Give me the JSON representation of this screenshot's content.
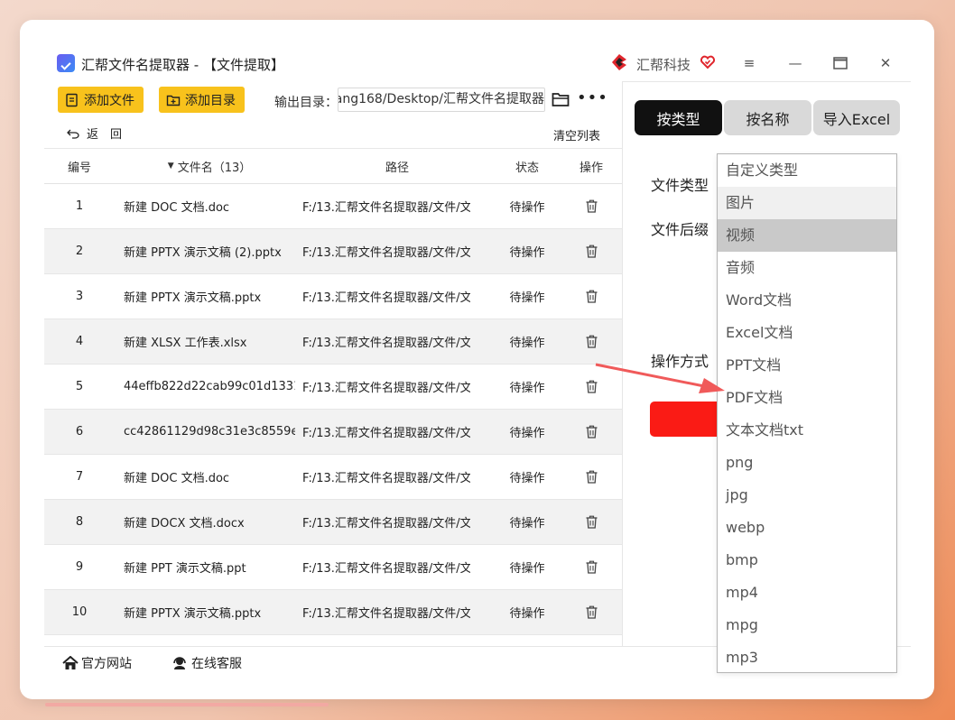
{
  "window": {
    "title": "汇帮文件名提取器 - 【文件提取】",
    "brand": "汇帮科技",
    "controls": {
      "menu": "≡",
      "minimize": "—",
      "maximize": "☐",
      "close": "✕"
    }
  },
  "toolbar": {
    "add_file": "添加文件",
    "add_dir": "添加目录",
    "output_label": "输出目录：",
    "output_path": "ang168/Desktop/汇帮文件名提取器",
    "more": "•••"
  },
  "subbar": {
    "back": "返　回",
    "clear": "清空列表"
  },
  "table": {
    "headers": {
      "num": "编号",
      "name": "文件名（13）",
      "path": "路径",
      "status": "状态",
      "op": "操作"
    },
    "rows": [
      {
        "num": "1",
        "name": "新建 DOC 文档.doc",
        "path": "F:/13.汇帮文件名提取器/文件/文...",
        "status": "待操作"
      },
      {
        "num": "2",
        "name": "新建 PPTX 演示文稿 (2).pptx",
        "path": "F:/13.汇帮文件名提取器/文件/文...",
        "status": "待操作"
      },
      {
        "num": "3",
        "name": "新建 PPTX 演示文稿.pptx",
        "path": "F:/13.汇帮文件名提取器/文件/文...",
        "status": "待操作"
      },
      {
        "num": "4",
        "name": "新建 XLSX 工作表.xlsx",
        "path": "F:/13.汇帮文件名提取器/文件/文...",
        "status": "待操作"
      },
      {
        "num": "5",
        "name": "44effb822d22cab99c01d1331...",
        "path": "F:/13.汇帮文件名提取器/文件/文...",
        "status": "待操作"
      },
      {
        "num": "6",
        "name": "cc42861129d98c31e3c8559e5...",
        "path": "F:/13.汇帮文件名提取器/文件/文...",
        "status": "待操作"
      },
      {
        "num": "7",
        "name": "新建 DOC 文档.doc",
        "path": "F:/13.汇帮文件名提取器/文件/文...",
        "status": "待操作"
      },
      {
        "num": "8",
        "name": "新建 DOCX 文档.docx",
        "path": "F:/13.汇帮文件名提取器/文件/文...",
        "status": "待操作"
      },
      {
        "num": "9",
        "name": "新建 PPT 演示文稿.ppt",
        "path": "F:/13.汇帮文件名提取器/文件/文...",
        "status": "待操作"
      },
      {
        "num": "10",
        "name": "新建 PPTX 演示文稿.pptx",
        "path": "F:/13.汇帮文件名提取器/文件/文...",
        "status": "待操作"
      }
    ]
  },
  "right_panel": {
    "tabs": [
      "按类型",
      "按名称",
      "导入Excel"
    ],
    "active_tab": "按类型",
    "labels": {
      "file_type": "文件类型",
      "file_ext": "文件后缀",
      "operation": "操作方式"
    }
  },
  "dropdown": {
    "options": [
      "自定义类型",
      "图片",
      "视频",
      "音频",
      "Word文档",
      "Excel文档",
      "PPT文档",
      "PDF文档",
      "文本文档txt",
      "png",
      "jpg",
      "webp",
      "bmp",
      "mp4",
      "mpg",
      "mp3"
    ],
    "hovered": "图片",
    "selected": "视频"
  },
  "footer": {
    "website": "官方网站",
    "support": "在线客服"
  },
  "colors": {
    "accent_yellow": "#f8c21c",
    "accent_red": "#fa1b15",
    "arrow_red": "#f05a5a"
  }
}
